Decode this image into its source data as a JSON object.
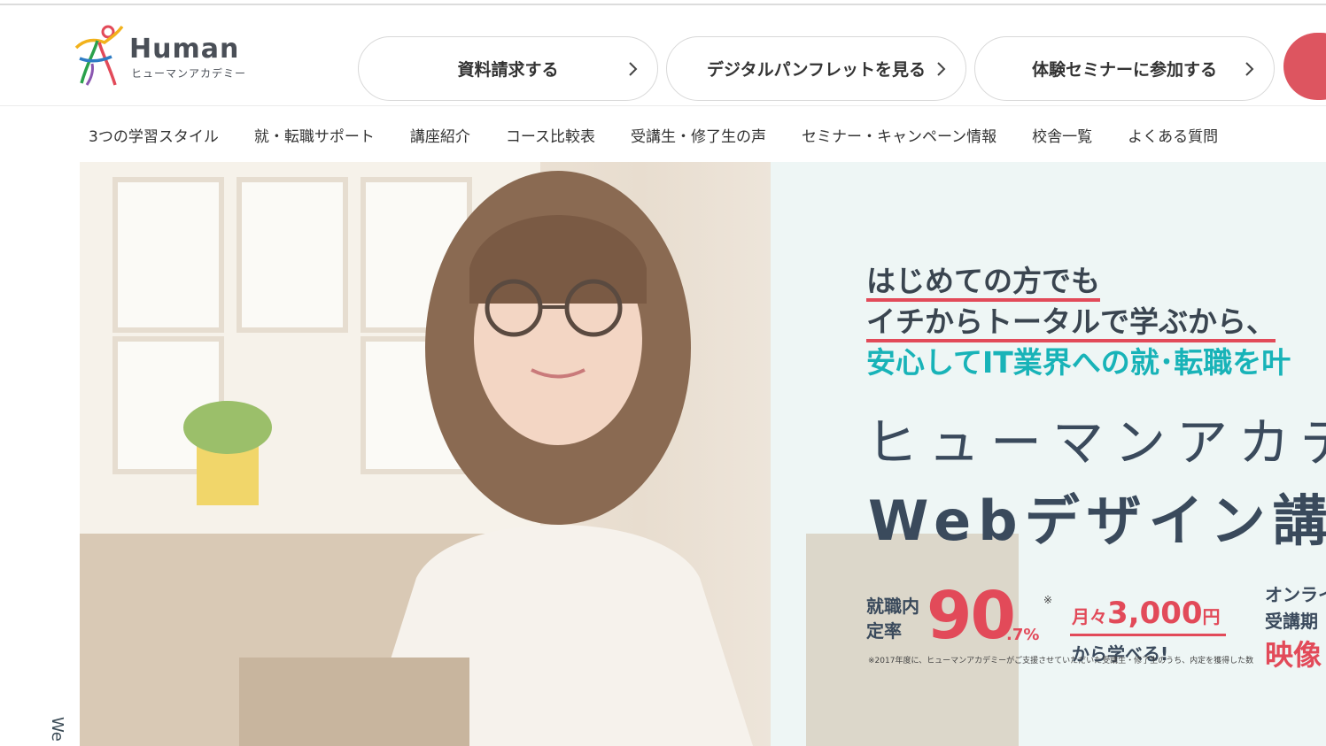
{
  "header": {
    "logo_word": "Human",
    "logo_sub": "ヒューマンアカデミー",
    "cta_buttons": [
      {
        "label": "資料請求する"
      },
      {
        "label": "デジタルパンフレットを見る"
      },
      {
        "label": "体験セミナーに参加する"
      }
    ],
    "colors": {
      "cta_red": "#dd5560",
      "accent_red": "#e24a59",
      "teal": "#18b3b8",
      "navy": "#3a4a5c"
    }
  },
  "nav": {
    "items": [
      {
        "label": "3つの学習スタイル"
      },
      {
        "label": "就・転職サポート"
      },
      {
        "label": "講座紹介"
      },
      {
        "label": "コース比較表"
      },
      {
        "label": "受講生・修了生の声"
      },
      {
        "label": "セミナー・キャンペーン情報"
      },
      {
        "label": "校舎一覧"
      },
      {
        "label": "よくある質問"
      }
    ]
  },
  "hero": {
    "line1": "はじめての方でも",
    "line2": "イチからトータルで学ぶから、",
    "line3": "安心してIT業界への就･転職を叶",
    "title1": "ヒューマンアカデ",
    "title2": "Webデザイン講",
    "stat_label": "就職内定率",
    "stat_value": "90",
    "stat_unit": ".7%",
    "stat_mark": "※",
    "price_prefix": "月々",
    "price_amount": "3,000",
    "price_suffix": "円",
    "price_sub": "から学べる!",
    "footnote": "※2017年度に、ヒューマンアカデミーがご支援させていただいた受講生・修了生のうち、内定を獲得した数",
    "online_1": "オンライ",
    "online_2": "受講期",
    "online_3": "映像",
    "side_text": "We"
  }
}
